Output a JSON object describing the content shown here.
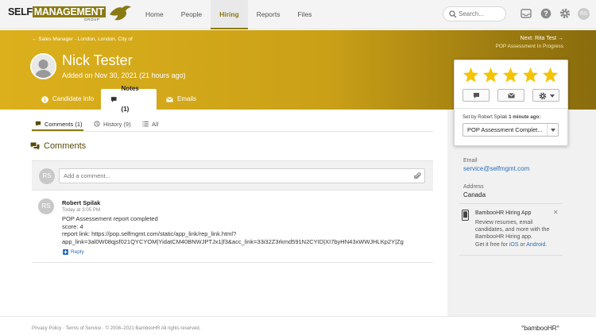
{
  "brand": {
    "logo_self": "SELF",
    "logo_mgmt": "MANAGEMENT",
    "logo_group": "GROUP"
  },
  "nav": {
    "items": [
      "Home",
      "People",
      "Hiring",
      "Reports",
      "Files"
    ],
    "active": "Hiring"
  },
  "search": {
    "placeholder": "Search..."
  },
  "user": {
    "initials": "RS"
  },
  "candidate": {
    "breadcrumb": "← Sales Manager - London, London, City of",
    "next_label": "Next: Rita Test →",
    "next_status": "POP Assessment In Progress",
    "name": "Nick Tester",
    "added": "Added on Nov 30, 2021 (21 hours ago)"
  },
  "header_tabs": [
    "Candidate Info",
    "Notes (1)",
    "Emails"
  ],
  "sub_tabs": [
    "Comments (1)",
    "History (9)",
    "All"
  ],
  "comments_section": {
    "title": "Comments",
    "input_placeholder": "Add a comment...",
    "avatar_initials": "RS"
  },
  "comment": {
    "author": "Robert Spilak",
    "time": "Today at 3:05 PM",
    "avatar_initials": "RS",
    "line1": "POP Assessement report completed",
    "line2": "score: 4",
    "line3": "report link: https://pop.selfmgmt.com/static/app_link/rep_link.html?",
    "line4": "app_link=3al0W08qjsf021QYCYOM|YidatCM40BNWJPTJx1|f3&acc_link=33i32Z3rkmd591N2CYID|XI7byHN43xWWJHLKp2Y|Zg",
    "reply": "Reply"
  },
  "rating": {
    "stars": 5,
    "star_color": "#f5c400",
    "set_by": "Set by Robert Spilak",
    "set_time": "1 minute ago:",
    "status": "POP Assessment Complet..."
  },
  "contact": {
    "email_label": "Email",
    "email": "service@selfmgmt.com",
    "address_label": "Address",
    "address": "Canada"
  },
  "promo": {
    "title": "BambooHR Hiring App",
    "body": "Review resumes, email candidates, and more with the BambooHR Hiring app.",
    "get_free": "Get it free for",
    "ios": "iOS",
    "or": "or",
    "android": "Android."
  },
  "footer": {
    "text": "Privacy Policy · Terms of Service · © 2008–2021 BambooHR All rights reserved.",
    "logo": "°bambooHR°"
  },
  "colors": {
    "accent": "#8a7a13",
    "header_start": "#dcb01c",
    "header_end": "#8a6c0e",
    "link": "#2e6fb8"
  }
}
